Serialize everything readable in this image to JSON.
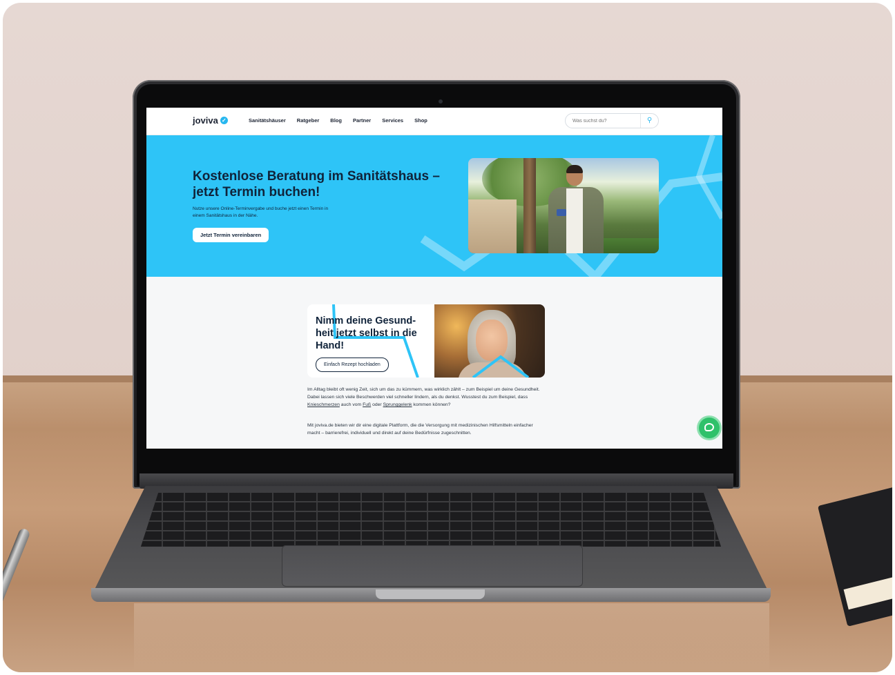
{
  "site": {
    "logo_text": "joviva",
    "logo_icon": "checkmark-badge-icon",
    "brand_color": "#2ec4f7",
    "nav": [
      "Sanitätshäuser",
      "Ratgeber",
      "Blog",
      "Partner",
      "Services",
      "Shop"
    ],
    "search_placeholder": "Was suchst du?",
    "search_icon": "search-icon"
  },
  "hero": {
    "title": "Kostenlose Beratung im Sanitätshaus – jetzt Termin buchen!",
    "subtitle": "Nutze unsere Online-Terminvergabe und buche jetzt einen Termin in einem Sanitätshaus in der Nähe.",
    "cta": "Jetzt Termin vereinbaren"
  },
  "card": {
    "title": "Nimm deine Gesund-heit jetzt selbst in die Hand!",
    "cta": "Einfach Rezept hochladen"
  },
  "paragraphs": {
    "p1_a": "Im Alltag bleibt oft wenig Zeit, sich um das zu kümmern, was wirklich zählt – zum Beispiel um deine Gesundheit. Dabei lassen sich viele Beschwerden viel schneller lindern, als du denkst. Wusstest du zum Beispiel, dass ",
    "p1_link1": "Knieschmerzen",
    "p1_b": " auch vom ",
    "p1_link2": "Fuß",
    "p1_c": " oder ",
    "p1_link3": "Sprunggelenk",
    "p1_d": " kommen können?",
    "p2": "Mit joviva.de bieten wir dir eine digitale Plattform, die die Versorgung mit medizinischen Hilfsmitteln einfacher macht – barrierefrei, individuell und direkt auf deine Bedürfnisse zugeschnitten."
  },
  "chat_icon": "chat-bubble-icon"
}
